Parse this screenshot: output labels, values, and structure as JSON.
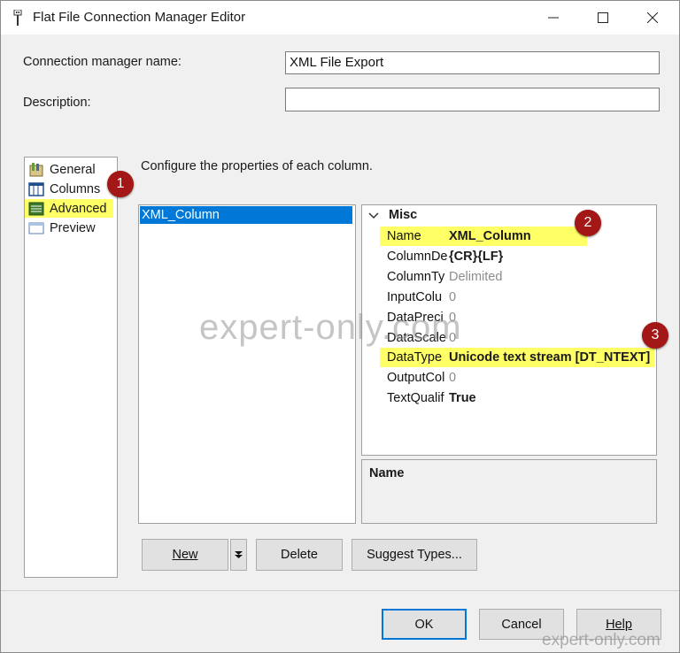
{
  "window": {
    "title": "Flat File Connection Manager Editor",
    "controls": {
      "minimize": "minimize-icon",
      "maximize": "maximize-icon",
      "close": "close-icon"
    }
  },
  "form": {
    "connection_name_label": "Connection manager name:",
    "connection_name_value": "XML File Export",
    "description_label": "Description:",
    "description_value": ""
  },
  "nav": {
    "items": [
      {
        "label": "General",
        "icon": "general-icon"
      },
      {
        "label": "Columns",
        "icon": "columns-icon"
      },
      {
        "label": "Advanced",
        "icon": "advanced-icon",
        "selected": true
      },
      {
        "label": "Preview",
        "icon": "preview-icon"
      }
    ]
  },
  "main": {
    "instruction": "Configure the properties of each column.",
    "columns": [
      "XML_Column"
    ]
  },
  "propgrid": {
    "category": "Misc",
    "rows": [
      {
        "name": "Name",
        "value": "XML_Column"
      },
      {
        "name": "ColumnDe",
        "value": "{CR}{LF}"
      },
      {
        "name": "ColumnTy",
        "value": "Delimited"
      },
      {
        "name": "InputColu",
        "value": "0"
      },
      {
        "name": "DataPreci",
        "value": "0"
      },
      {
        "name": "DataScale",
        "value": "0"
      },
      {
        "name": "DataType",
        "value": "Unicode text stream [DT_NTEXT]"
      },
      {
        "name": "OutputCol",
        "value": "0"
      },
      {
        "name": "TextQualif",
        "value": "True"
      }
    ],
    "description_title": "Name"
  },
  "buttons": {
    "new": "New",
    "delete": "Delete",
    "suggest": "Suggest Types...",
    "ok": "OK",
    "cancel": "Cancel",
    "help": "Help"
  },
  "annotations": [
    "1",
    "2",
    "3"
  ],
  "watermark": {
    "main": "expert-only.com",
    "corner": "expert-only.com"
  },
  "colors": {
    "highlight": "#ffff66",
    "selection": "#0078d7",
    "badge": "#a31717"
  }
}
